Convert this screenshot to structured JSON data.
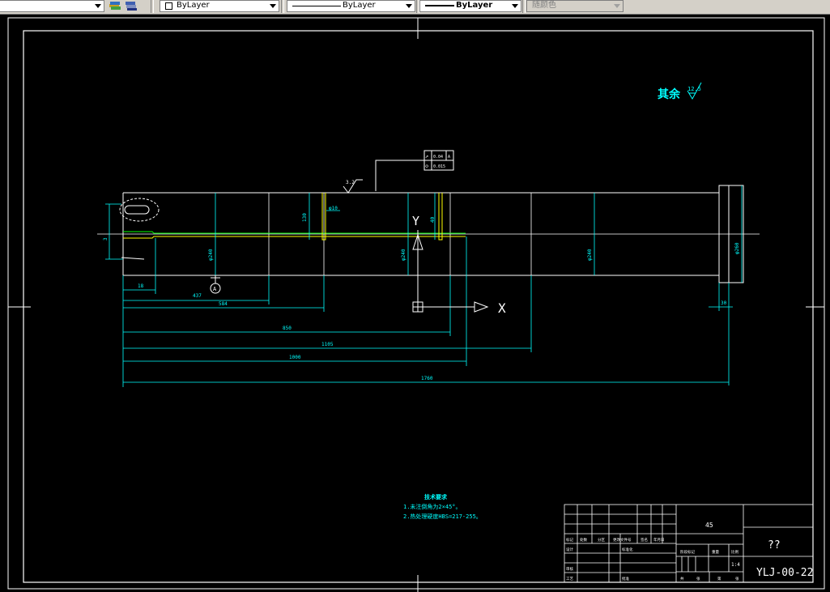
{
  "toolbar": {
    "layer_icons": [
      "layer-stack-icon",
      "layer-states-icon"
    ],
    "color_combo": "ByLayer",
    "linetype_combo": "ByLayer",
    "lineweight_combo": "ByLayer",
    "plotstyle_combo": "随颜色"
  },
  "drawing": {
    "roughness_label": "其余",
    "roughness_value": "12.5",
    "surface_finish": "3.2",
    "tolerance": {
      "runout": "0.04",
      "runout_datum": "A",
      "cylindricity": "0.015"
    },
    "datum_label": "A",
    "ucs": {
      "x_label": "X",
      "y_label": "Y"
    },
    "dims": {
      "d18": "18",
      "d437": "437",
      "d584": "584",
      "d850": "850",
      "d1105": "1105",
      "d1000": "1000",
      "d1760": "1760",
      "d30": "30",
      "phi10": "φ10",
      "d130": "130",
      "d40": "40",
      "d3": "3",
      "phi_a": "φ240",
      "phi_b": "φ240",
      "phi_c": "φ240",
      "phi_d": "φ260"
    },
    "tech_req": {
      "title": "技术要求",
      "line1": "1.未注倒角为2×45°。",
      "line2": "2.热处理硬度HBS=217-255。"
    },
    "title_block": {
      "material": "45",
      "part_name": "??",
      "drawing_no": "YLJ-00-22",
      "scale": "1:4",
      "labels": [
        "标记",
        "处数",
        "分区",
        "更改文件号",
        "签名",
        "年月日",
        "设计",
        "标准化",
        "审核",
        "工艺",
        "批准",
        "阶段标记",
        "重量",
        "比例",
        "共",
        "张",
        "第",
        "张"
      ]
    }
  }
}
